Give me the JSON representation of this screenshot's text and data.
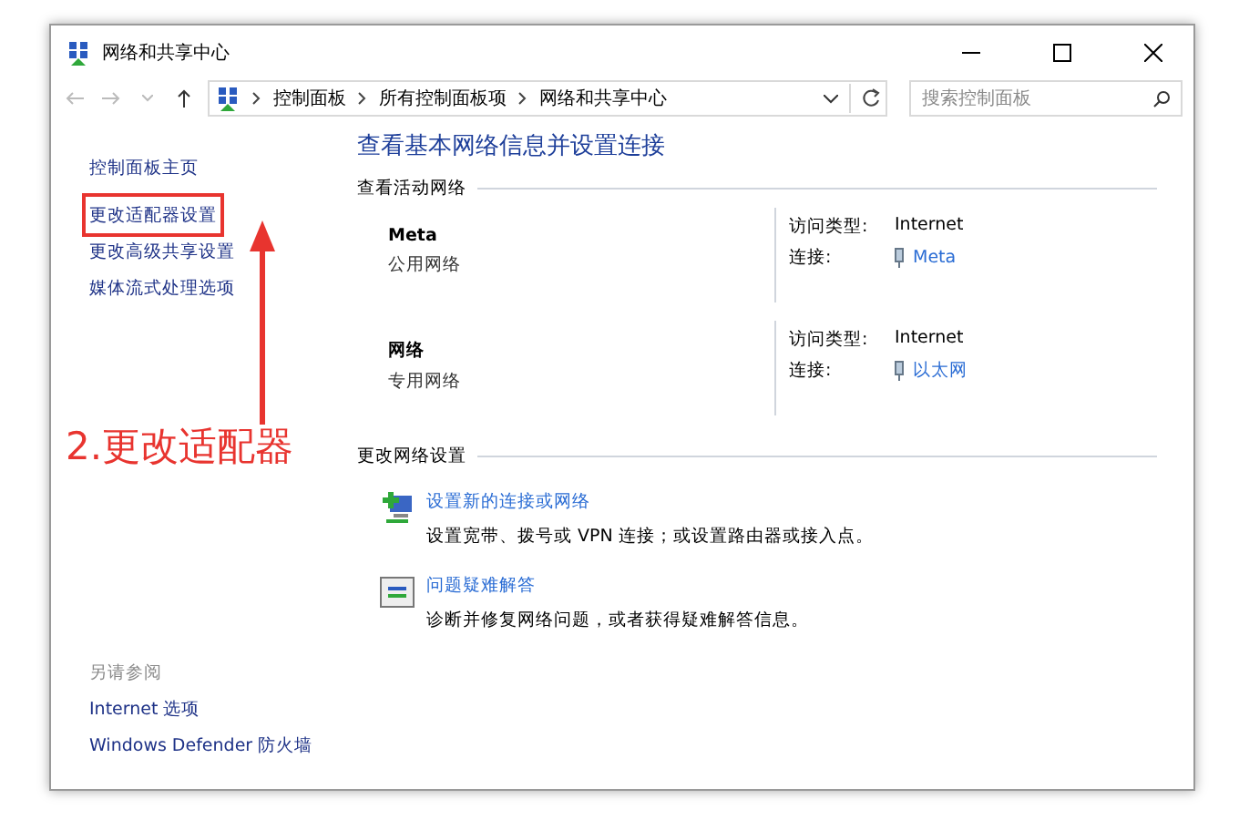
{
  "window": {
    "title": "网络和共享中心"
  },
  "address": {
    "breadcrumbs": [
      "控制面板",
      "所有控制面板项",
      "网络和共享中心"
    ],
    "search_placeholder": "搜索控制面板"
  },
  "sidebar": {
    "items": [
      {
        "label": "控制面板主页",
        "annotated": false
      },
      {
        "label": "更改适配器设置",
        "annotated": true
      },
      {
        "label": "更改高级共享设置",
        "annotated": false
      },
      {
        "label": "媒体流式处理选项",
        "annotated": false
      }
    ],
    "see_also": {
      "heading": "另请参阅",
      "items": [
        "Internet 选项",
        "Windows Defender 防火墙"
      ]
    }
  },
  "annotation": {
    "text": "2.更改适配器"
  },
  "main": {
    "heading": "查看基本网络信息并设置连接",
    "active_networks": {
      "heading": "查看活动网络",
      "networks": [
        {
          "name": "Meta",
          "type": "公用网络",
          "access_label": "访问类型:",
          "access_value": "Internet",
          "connection_label": "连接:",
          "connection_value": "Meta"
        },
        {
          "name": "网络",
          "type": "专用网络",
          "access_label": "访问类型:",
          "access_value": "Internet",
          "connection_label": "连接:",
          "connection_value": "以太网"
        }
      ]
    },
    "change_settings": {
      "heading": "更改网络设置",
      "tasks": [
        {
          "kind": "setup",
          "title": "设置新的连接或网络",
          "description": "设置宽带、拨号或 VPN 连接；或设置路由器或接入点。"
        },
        {
          "kind": "troubleshoot",
          "title": "问题疑难解答",
          "description": "诊断并修复网络问题，或者获得疑难解答信息。"
        }
      ]
    }
  }
}
